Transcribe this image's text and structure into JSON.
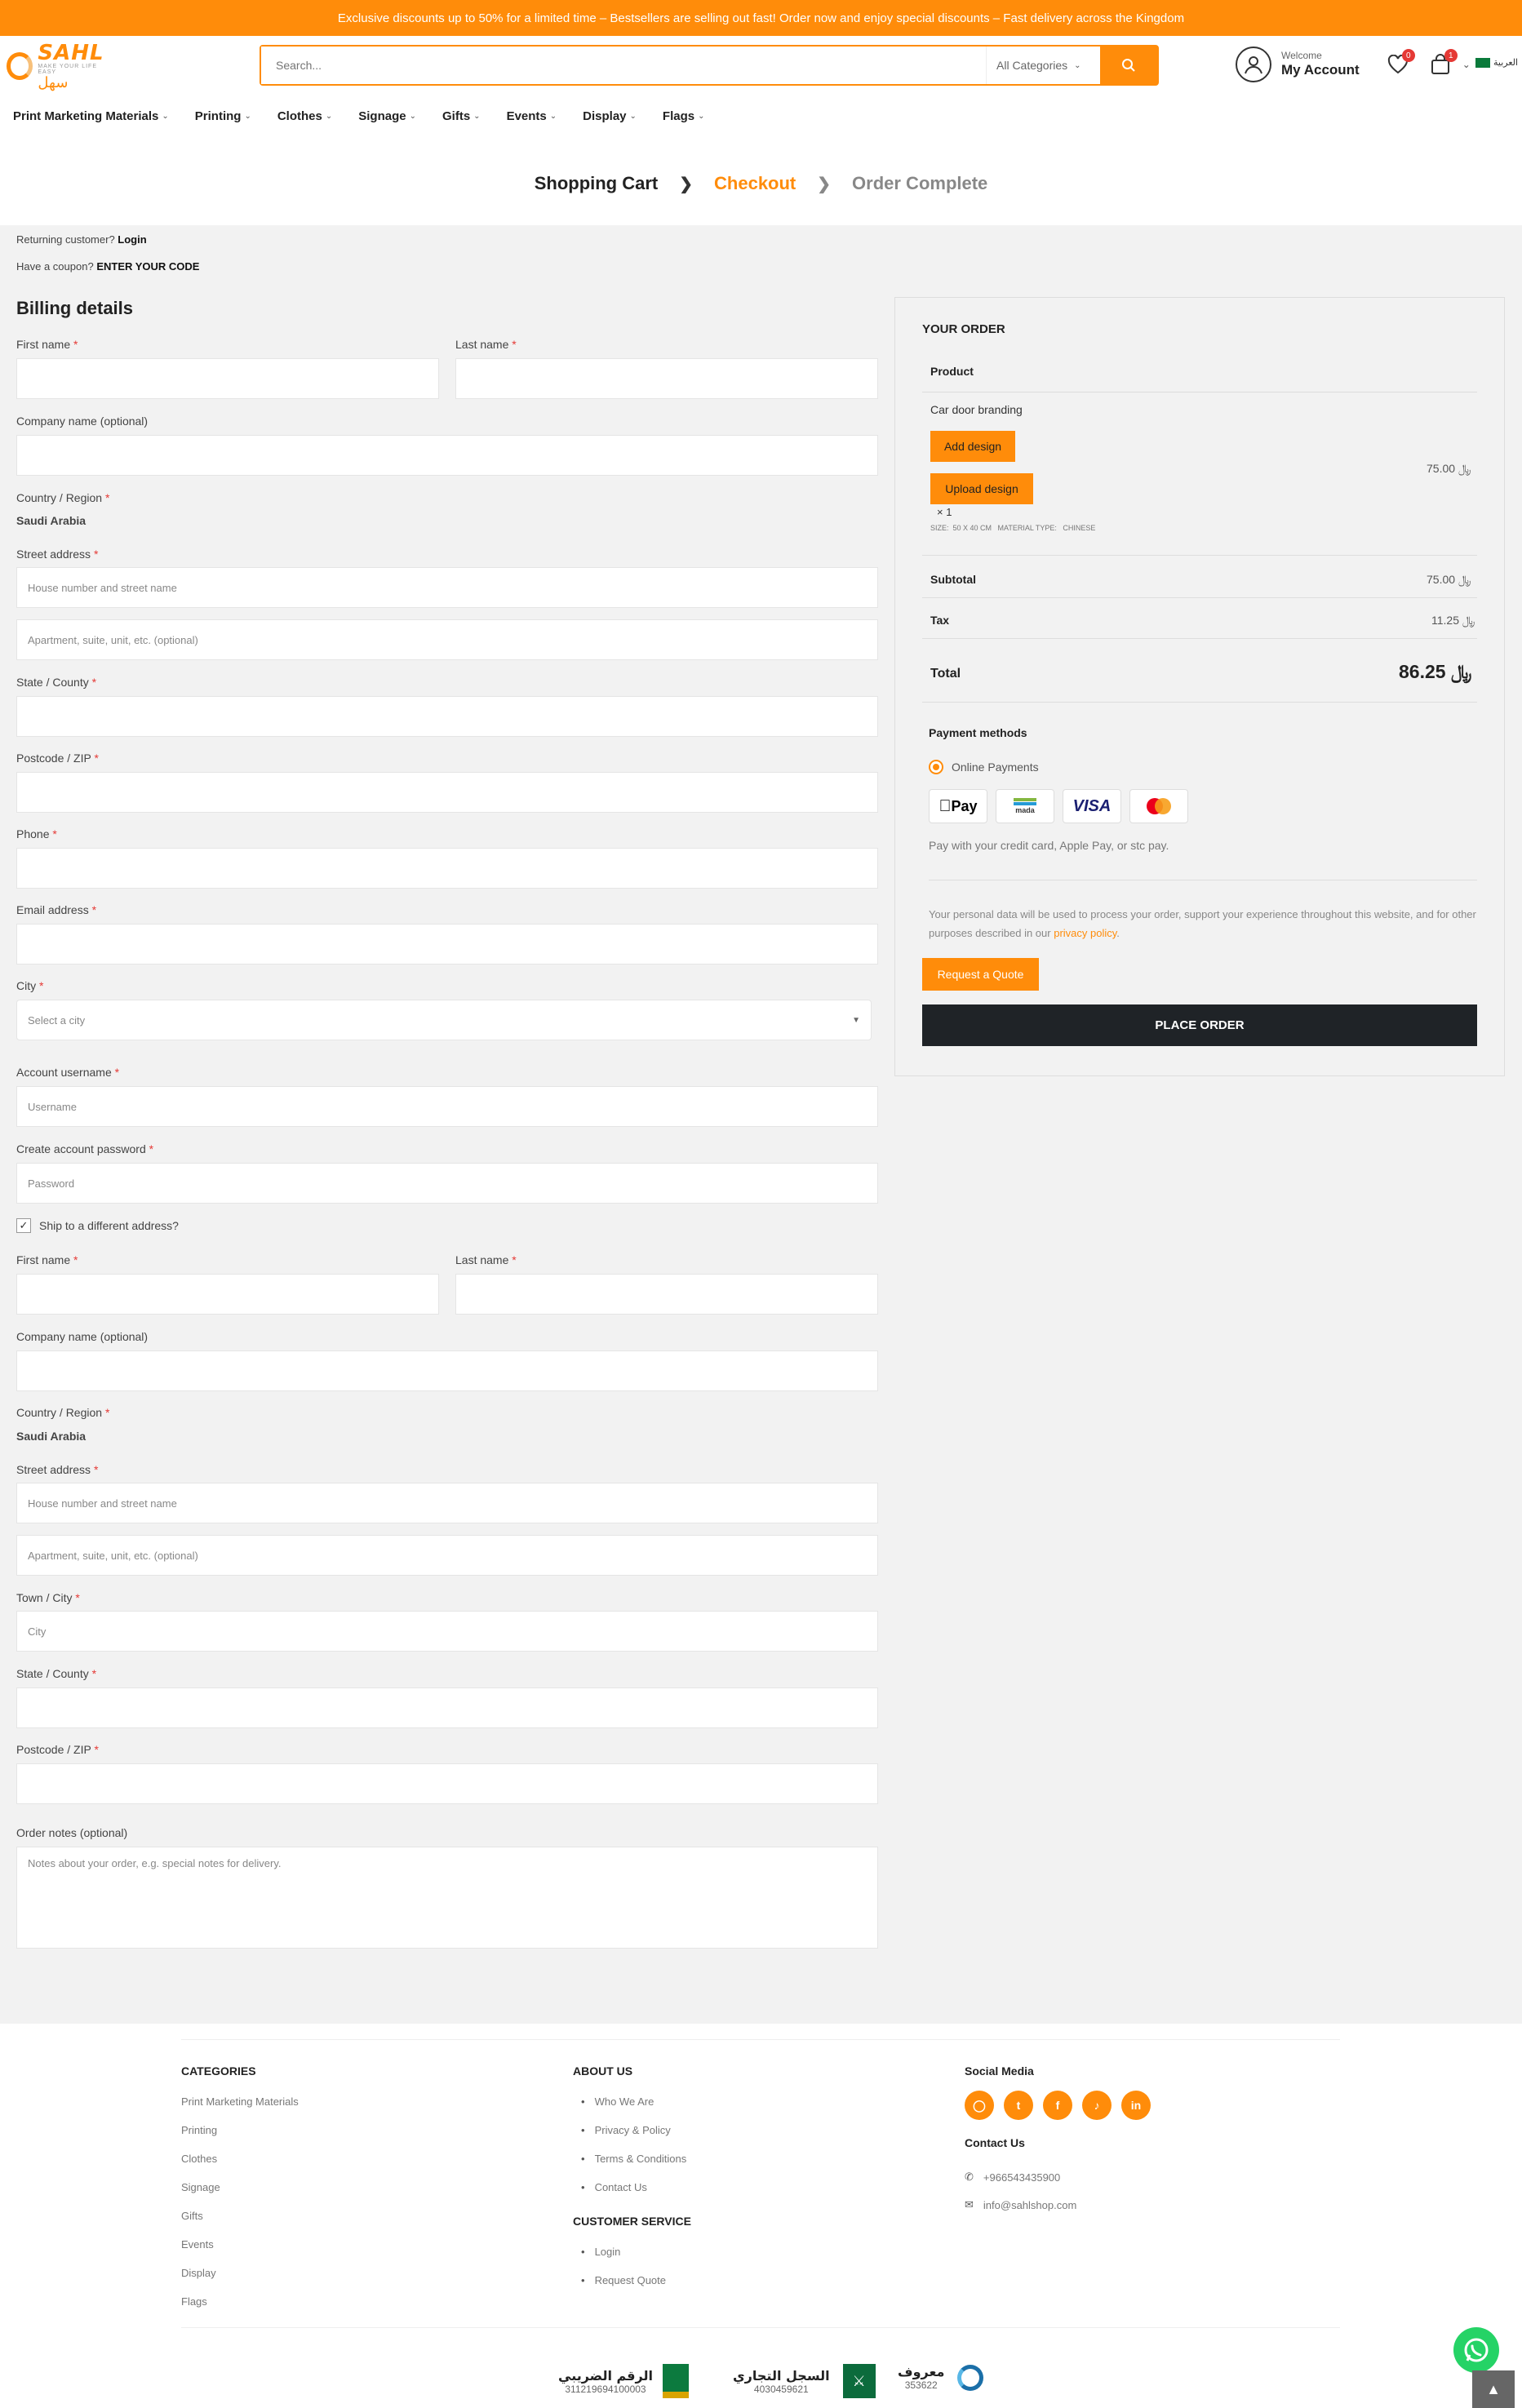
{
  "banner": {
    "text": "Exclusive discounts up to 50% for a limited time – Bestsellers are selling out fast! Order now and enjoy special discounts – Fast delivery across the Kingdom"
  },
  "header": {
    "logo_text": "SAHL",
    "logo_tagline": "MAKE YOUR LIFE EASY",
    "logo_arabic": "سهل",
    "search_placeholder": "Search...",
    "search_category": "All Categories",
    "account_welcome": "Welcome",
    "account_label": "My Account",
    "wishlist_count": "0",
    "cart_count": "1",
    "language": "العربية"
  },
  "nav": [
    {
      "label": "Print Marketing Materials"
    },
    {
      "label": "Printing"
    },
    {
      "label": "Clothes"
    },
    {
      "label": "Signage"
    },
    {
      "label": "Gifts"
    },
    {
      "label": "Events"
    },
    {
      "label": "Display"
    },
    {
      "label": "Flags"
    }
  ],
  "steps": {
    "cart": "Shopping Cart",
    "checkout": "Checkout",
    "complete": "Order Complete"
  },
  "notices": {
    "returning": "Returning customer?",
    "login": "Login",
    "coupon": "Have a coupon?",
    "coupon_link": "ENTER YOUR CODE"
  },
  "billing": {
    "title": "Billing details",
    "first_name": "First name",
    "last_name": "Last name",
    "company": "Company name (optional)",
    "country_label": "Country / Region",
    "country_value": "Saudi Arabia",
    "street_label": "Street address",
    "street_placeholder": "House number and street name",
    "apartment_placeholder": "Apartment, suite, unit, etc. (optional)",
    "state": "State / County",
    "postcode": "Postcode / ZIP",
    "phone": "Phone",
    "email": "Email address",
    "city": "City",
    "city_placeholder": "Select a city",
    "username_label": "Account username",
    "username_placeholder": "Username",
    "password_label": "Create account password",
    "password_placeholder": "Password",
    "ship_different": "Ship to a different address?",
    "required_mark": "*"
  },
  "shipping": {
    "first_name": "First name",
    "last_name": "Last name",
    "company": "Company name (optional)",
    "country_label": "Country / Region",
    "country_value": "Saudi Arabia",
    "street_label": "Street address",
    "street_placeholder": "House number and street name",
    "apartment_placeholder": "Apartment, suite, unit, etc. (optional)",
    "town_label": "Town / City",
    "town_placeholder": "City",
    "state": "State / County",
    "postcode": "Postcode / ZIP",
    "notes_label": "Order notes (optional)",
    "notes_placeholder": "Notes about your order, e.g. special notes for delivery."
  },
  "order": {
    "title": "YOUR ORDER",
    "product_header": "Product",
    "product_name": "Car door branding",
    "add_design": "Add design",
    "upload_design": "Upload design",
    "quantity": "× 1",
    "meta": "SIZE:  50 X 40 CM   MATERIAL TYPE:   CHINESE",
    "product_price": "75.00",
    "subtotal_label": "Subtotal",
    "subtotal_value": "75.00",
    "tax_label": "Tax",
    "tax_value": "11.25",
    "total_label": "Total",
    "total_value": "86.25",
    "payment_title": "Payment methods",
    "payment_option": "Online Payments",
    "payment_desc": "Pay with your credit card, Apple Pay, or stc pay.",
    "privacy_text": "Your personal data will be used to process your order, support your experience throughout this website, and for other purposes described in our",
    "privacy_link": "privacy policy",
    "request_quote": "Request a Quote",
    "place_order": "PLACE ORDER",
    "pay_apple": "Pay",
    "pay_mada": "mada",
    "pay_visa": "VISA"
  },
  "footer": {
    "categories_title": "CATEGORIES",
    "categories": [
      "Print Marketing Materials",
      "Printing",
      "Clothes",
      "Signage",
      "Gifts",
      "Events",
      "Display",
      "Flags"
    ],
    "about_title": "ABOUT US",
    "about": [
      "Who We Are",
      "Privacy & Policy",
      "Terms & Conditions",
      "Contact Us"
    ],
    "service_title": "CUSTOMER SERVICE",
    "service": [
      "Login",
      "Request Quote"
    ],
    "social_title": "Social Media",
    "contact_title": "Contact Us",
    "phone": "+966543435900",
    "email": "info@sahlshop.com",
    "cert_tax_label": "الرقم الضريبي",
    "cert_tax_num": "311219694100003",
    "cert_cr_label": "السجل التجاري",
    "cert_cr_num": "4030459621",
    "cert_maroof_label": "معروف",
    "cert_maroof_num": "353622"
  },
  "colors": {
    "accent": "#ff8c0a",
    "dark": "#1f2327",
    "required": "#e53935"
  }
}
